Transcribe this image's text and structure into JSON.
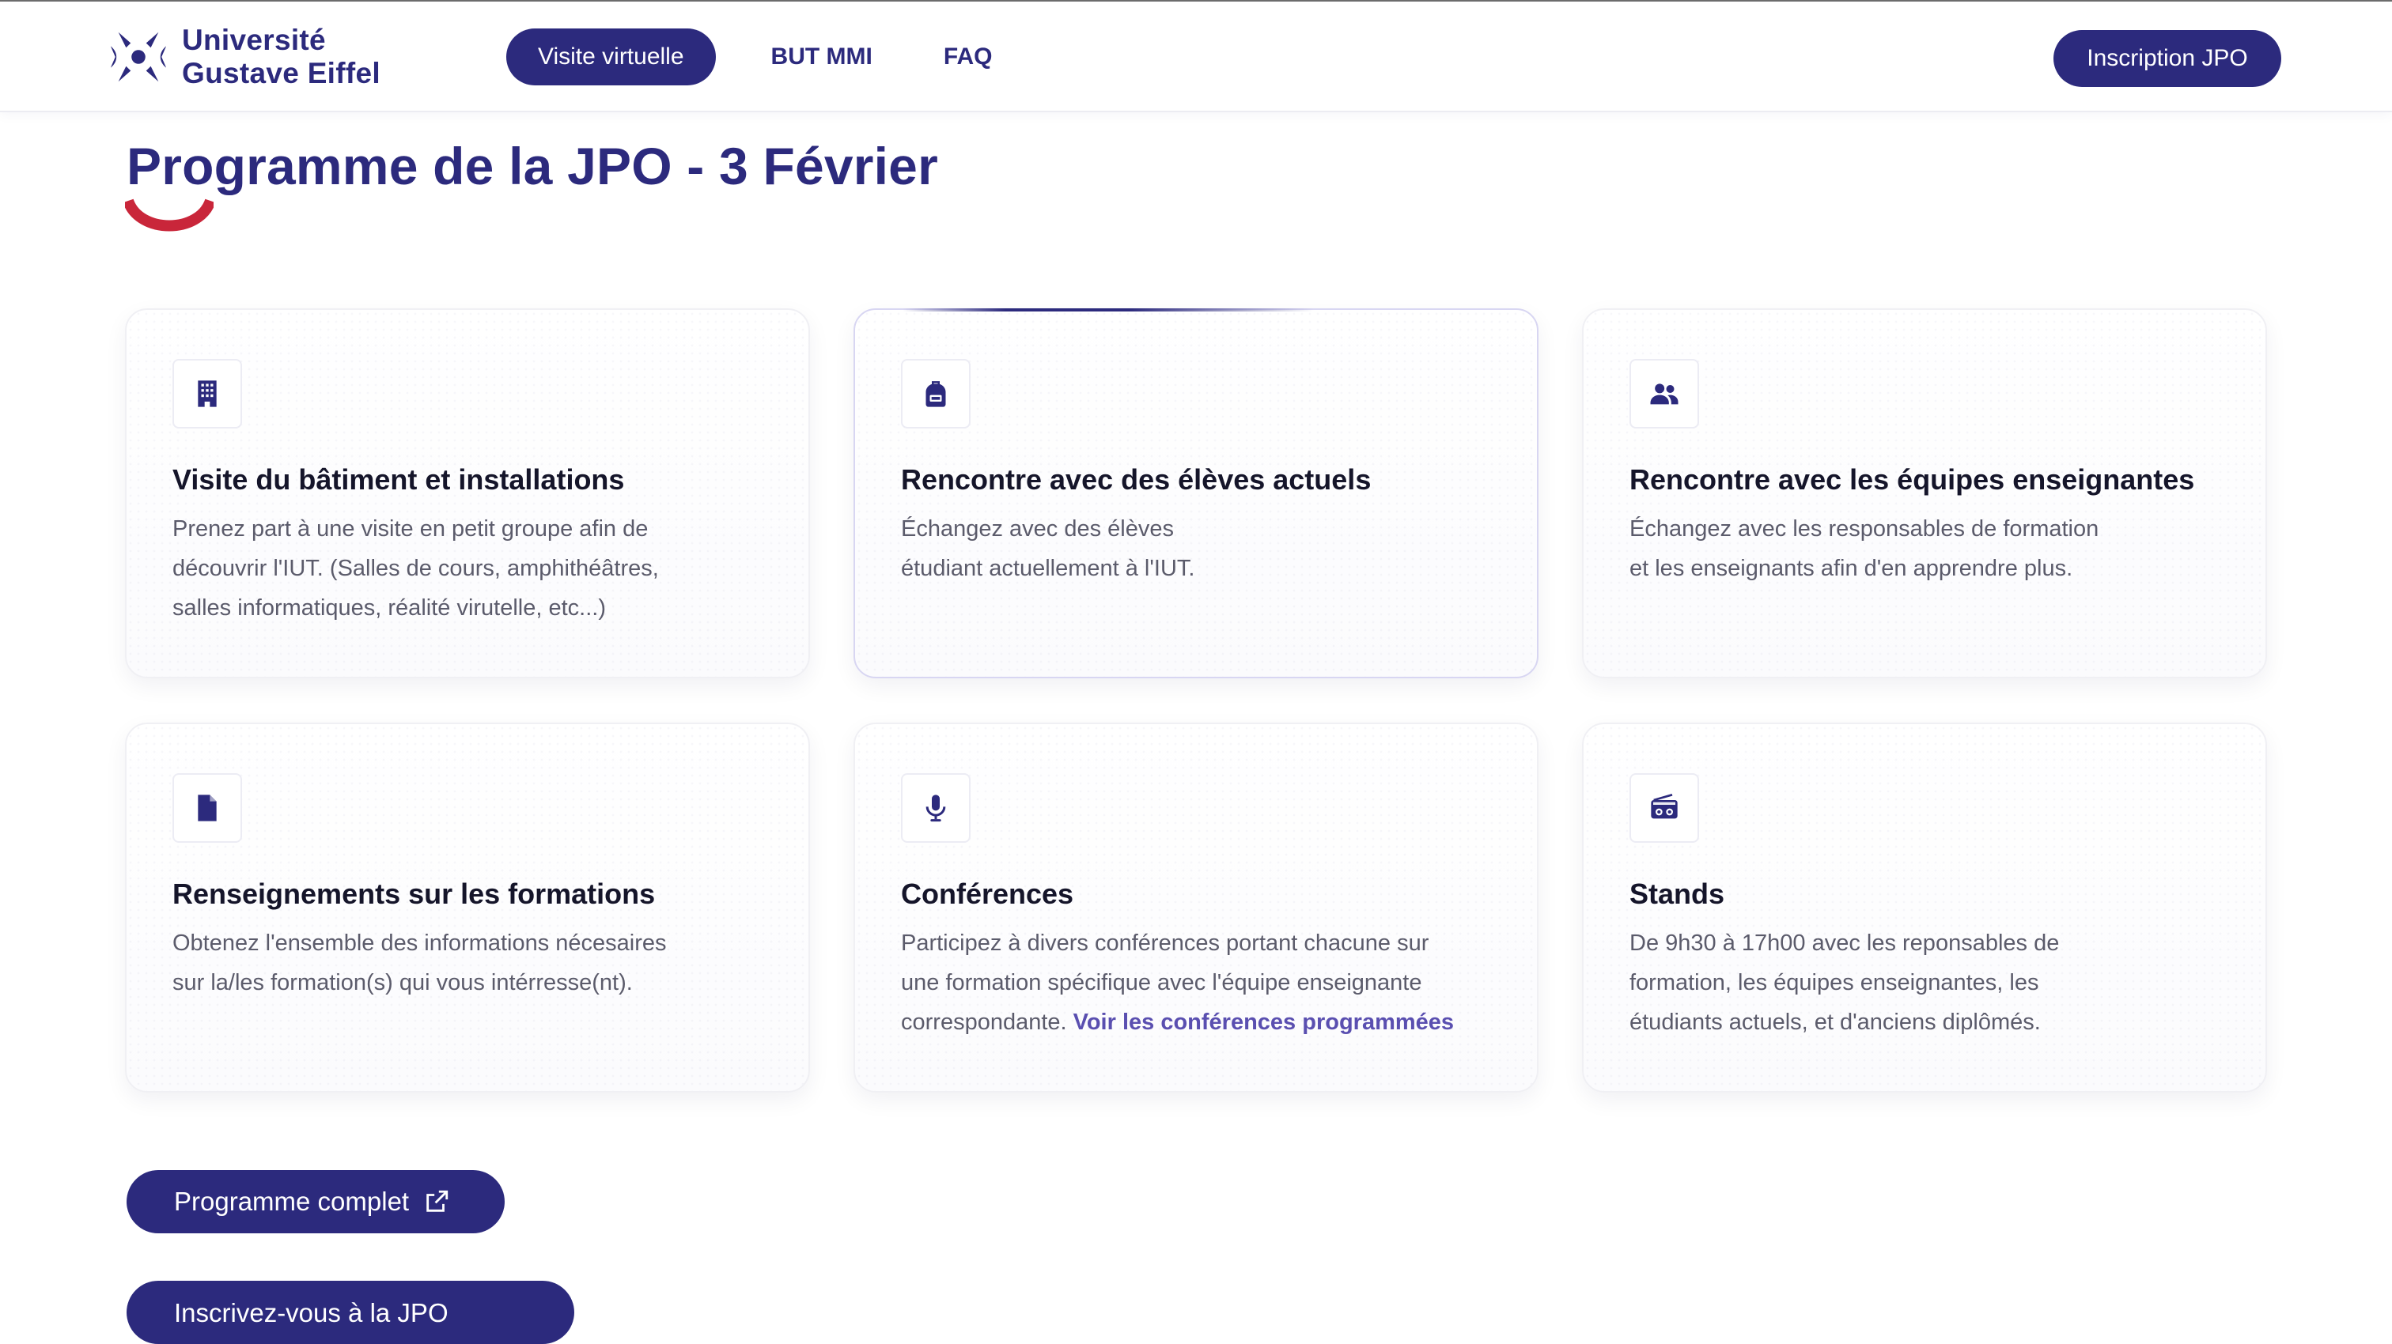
{
  "colors": {
    "brand": "#2c2a7d",
    "accent_red": "#c9263a",
    "link": "#5a4fb0"
  },
  "header": {
    "logo": {
      "line1": "Université",
      "line2": "Gustave Eiffel"
    },
    "nav": {
      "visit_label": "Visite virtuelle",
      "but_label": "BUT MMI",
      "faq_label": "FAQ"
    },
    "cta_label": "Inscription JPO"
  },
  "main": {
    "title": "Programme de la JPO - 3 Février",
    "cards": [
      {
        "icon": "building-icon",
        "title": "Visite du bâtiment et installations",
        "lines": [
          "Prenez part à une visite en petit groupe afin de",
          "découvrir l'IUT. (Salles de cours, amphithéâtres,",
          "salles informatiques, réalité virutelle, etc...)"
        ]
      },
      {
        "icon": "backpack-icon",
        "title": "Rencontre avec des élèves actuels",
        "lines": [
          "Échangez avec des élèves",
          "étudiant actuellement à l'IUT."
        ]
      },
      {
        "icon": "people-icon",
        "title": "Rencontre avec les équipes enseignantes",
        "lines": [
          "Échangez avec les responsables de formation",
          "et les enseignants afin d'en apprendre plus."
        ]
      },
      {
        "icon": "document-icon",
        "title": "Renseignements sur les formations",
        "lines": [
          "Obtenez l'ensemble des informations nécesaires",
          "sur la/les formation(s) qui vous intérresse(nt)."
        ]
      },
      {
        "icon": "microphone-icon",
        "title": "Conférences",
        "lines": [
          "Participez à divers conférences portant chacune sur",
          "une formation spécifique avec l'équipe enseignante",
          "correspondante."
        ],
        "link": "Voir les conférences programmées"
      },
      {
        "icon": "radio-icon",
        "title": "Stands",
        "lines": [
          "De 9h30 à 17h00 avec les reponsables de",
          "formation, les équipes enseignantes, les",
          "étudiants actuels, et d'anciens diplômés."
        ]
      }
    ],
    "program_button": "Programme complet",
    "second_button": "Inscrivez-vous à la JPO"
  }
}
